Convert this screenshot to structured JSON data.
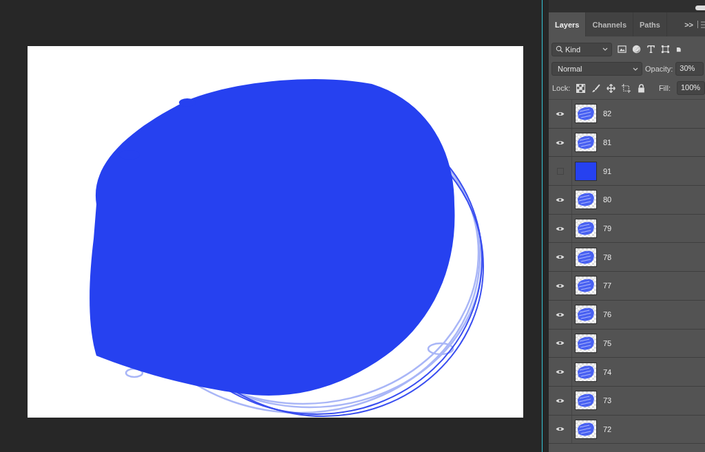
{
  "tabs": [
    {
      "label": "Layers",
      "selected": true
    },
    {
      "label": "Channels",
      "selected": false
    },
    {
      "label": "Paths",
      "selected": false
    }
  ],
  "panel_menu": {
    "expand": ">>"
  },
  "filter": {
    "label": "Kind"
  },
  "blend_mode": "Normal",
  "opacity_label": "Opacity:",
  "opacity": "30%",
  "lock_label": "Lock:",
  "fill_label": "Fill:",
  "fill": "100%",
  "layers": [
    {
      "name": "82",
      "visible": true,
      "kind": "stroke"
    },
    {
      "name": "81",
      "visible": true,
      "kind": "stroke"
    },
    {
      "name": "91",
      "visible": false,
      "kind": "fill"
    },
    {
      "name": "80",
      "visible": true,
      "kind": "stroke"
    },
    {
      "name": "79",
      "visible": true,
      "kind": "stroke"
    },
    {
      "name": "78",
      "visible": true,
      "kind": "stroke"
    },
    {
      "name": "77",
      "visible": true,
      "kind": "stroke"
    },
    {
      "name": "76",
      "visible": true,
      "kind": "stroke"
    },
    {
      "name": "75",
      "visible": true,
      "kind": "stroke"
    },
    {
      "name": "74",
      "visible": true,
      "kind": "stroke"
    },
    {
      "name": "73",
      "visible": true,
      "kind": "stroke"
    },
    {
      "name": "72",
      "visible": true,
      "kind": "stroke"
    }
  ]
}
